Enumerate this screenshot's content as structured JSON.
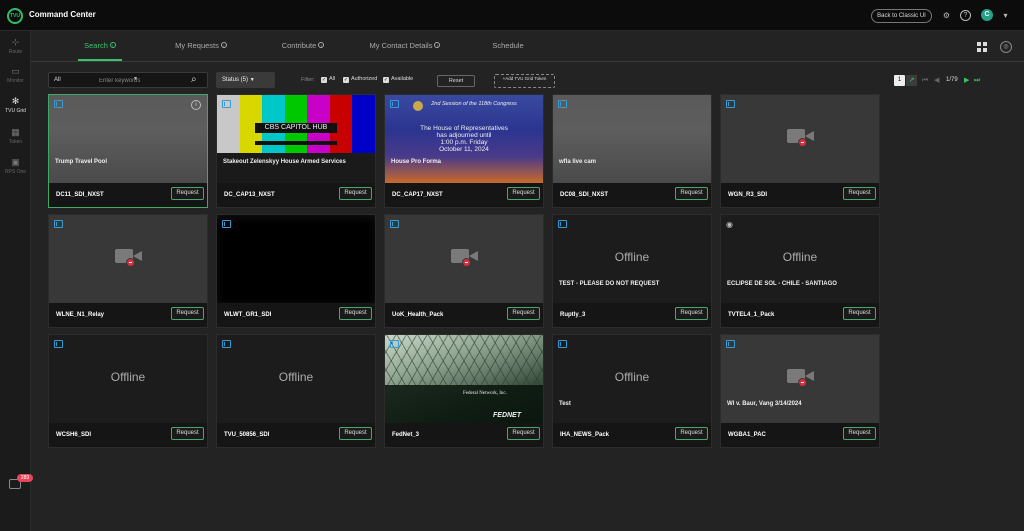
{
  "app": {
    "logo": "TVU",
    "title": "Command Center",
    "classic_button": "Back to Classic UI",
    "avatar_initial": "C"
  },
  "sidebar": {
    "items": [
      {
        "label": "Route",
        "icon": "route-icon"
      },
      {
        "label": "Monitor",
        "icon": "monitor-icon"
      },
      {
        "label": "TVU Grid",
        "icon": "tvu-grid-icon"
      },
      {
        "label": "Token",
        "icon": "token-icon"
      },
      {
        "label": "RPS One",
        "icon": "rps-one-icon"
      }
    ],
    "notification_badge": "289"
  },
  "tabs": [
    {
      "label": "Search"
    },
    {
      "label": "My Requests"
    },
    {
      "label": "Contribute"
    },
    {
      "label": "My Contact Details"
    },
    {
      "label": "Schedule"
    }
  ],
  "toolbar": {
    "search_scope": "All",
    "search_placeholder": "Enter keywords",
    "status_label": "Status (5)",
    "filter_label": "Filter:",
    "filters": [
      {
        "label": "All"
      },
      {
        "label": "Authorized"
      },
      {
        "label": "Available"
      }
    ],
    "reset_label": "Reset",
    "add_token_label": "+Add TVU Grid Token",
    "page_current": "1",
    "page_count": "1/79"
  },
  "cards": [
    {
      "name": "DC11_SDI_NXST",
      "caption": "Trump Travel Pool",
      "thumb": "blur",
      "icon": "info",
      "selected": true
    },
    {
      "name": "DC_CAP13_NXST",
      "caption": "Stakeout Zelenskyy House Armed Services",
      "thumb": "bars",
      "overlay": "CBS CAPITOL HUB"
    },
    {
      "name": "DC_CAP17_NXST",
      "caption": "House Pro Forma",
      "thumb": "congress",
      "lines": [
        "2nd Session of the 118th Congress",
        "The House of Representatives",
        "has adjourned until",
        "1:00 p.m. Friday",
        "October 11, 2024"
      ]
    },
    {
      "name": "DC08_SDI_NXST",
      "caption": "wfla live cam",
      "thumb": "blur"
    },
    {
      "name": "WGN_R3_SDI",
      "caption": "",
      "thumb": "camera"
    },
    {
      "name": "WLNE_N1_Relay",
      "caption": "",
      "thumb": "camera"
    },
    {
      "name": "WLWT_GR1_SDI",
      "caption": "",
      "thumb": "black"
    },
    {
      "name": "UoK_Health_Pack",
      "caption": "",
      "thumb": "camera"
    },
    {
      "name": "Ruptly_3",
      "caption": "TEST - PLEASE DO NOT REQUEST",
      "thumb": "offline",
      "offline_label": "Offline"
    },
    {
      "name": "TVTEL4_1_Pack",
      "caption": "ECLIPSE DE SOL - CHILE - SANTIAGO",
      "thumb": "offline",
      "offline_label": "Offline",
      "icon": "eye"
    },
    {
      "name": "WCSH6_SDI",
      "caption": "",
      "thumb": "offline",
      "offline_label": "Offline"
    },
    {
      "name": "TVU_50856_SDI",
      "caption": "",
      "thumb": "offline",
      "offline_label": "Offline"
    },
    {
      "name": "FedNet_3",
      "caption": "",
      "thumb": "fednet",
      "brand": "Federal Network, Inc.",
      "brand2": "FEDNET"
    },
    {
      "name": "IHA_NEWS_Pack",
      "caption": "Test",
      "thumb": "offline",
      "offline_label": "Offline"
    },
    {
      "name": "WGBA1_PAC",
      "caption": "WI v. Baur, Vang 3/14/2024",
      "thumb": "camera"
    }
  ],
  "request_label": "Request",
  "colors": {
    "accent": "#3cc06c",
    "badge": "#e8455a",
    "tvu_icon": "#3a9ad1"
  }
}
